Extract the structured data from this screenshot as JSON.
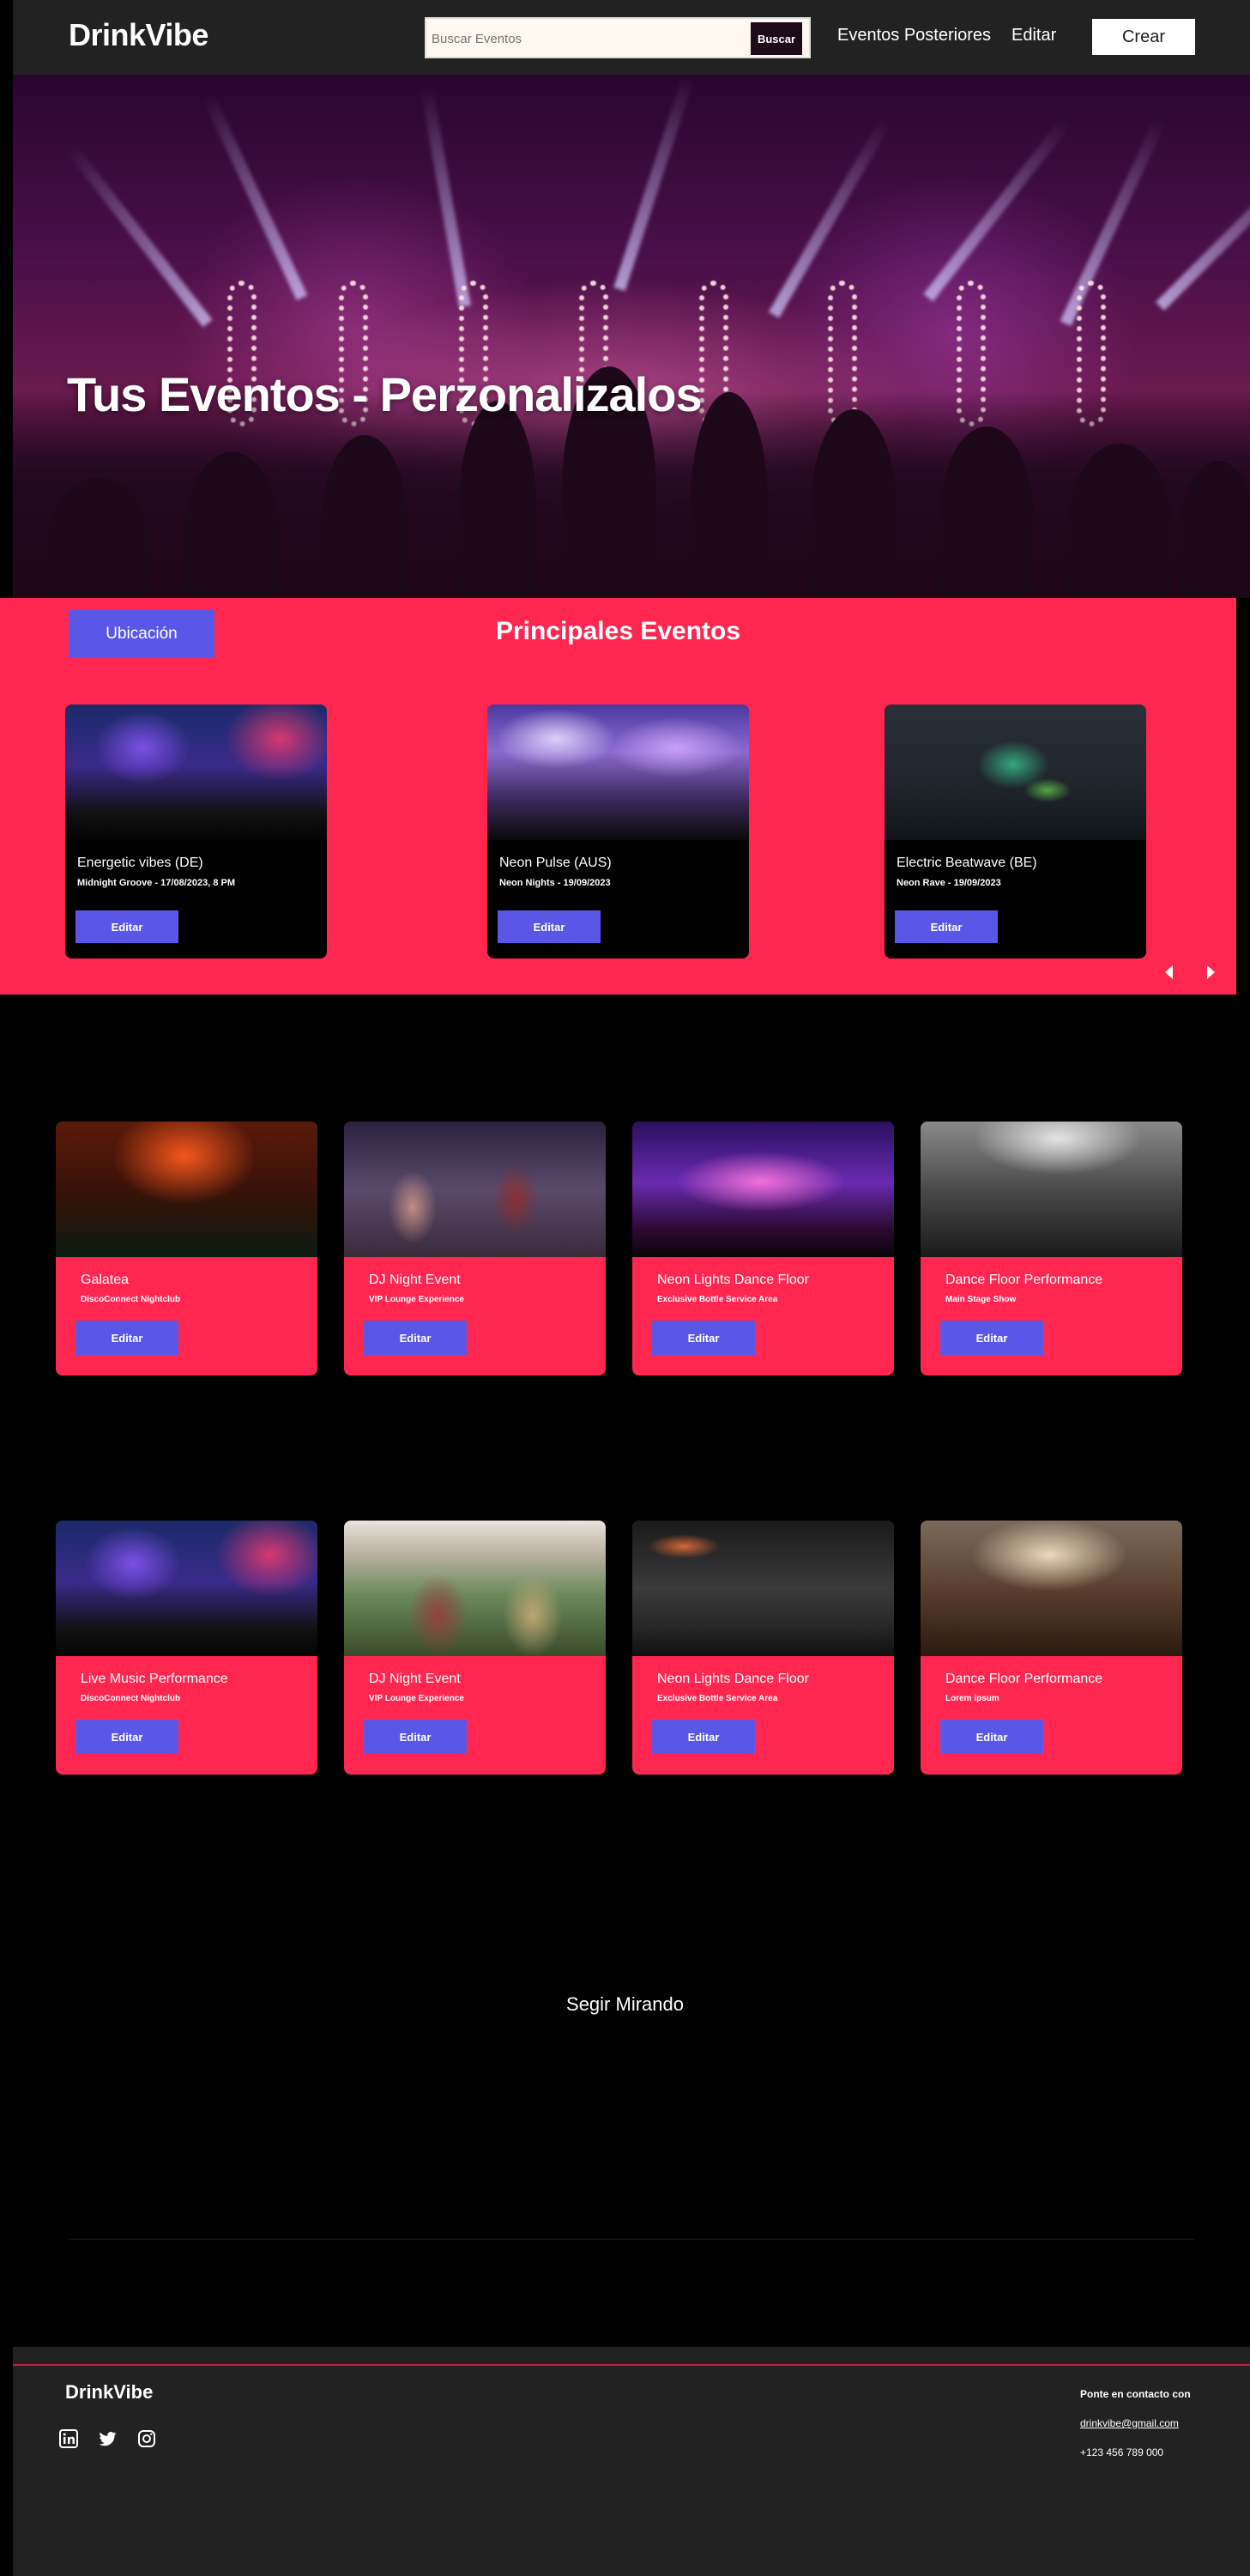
{
  "nav": {
    "brand": "DrinkVibe",
    "search_placeholder": "Buscar Eventos",
    "search_button": "Buscar",
    "links": [
      "Eventos Posteriores",
      "Editar"
    ],
    "create_button": "Crear"
  },
  "hero": {
    "title": "Tus Eventos - Perzonalizalos"
  },
  "principales": {
    "location_button": "Ubicación",
    "title": "Principales Eventos",
    "cards": [
      {
        "title": "Energetic vibes (DE)",
        "subtitle": "Midnight Groove - 17/08/2023, 8 PM",
        "button": "Editar",
        "image": "stage-crowd"
      },
      {
        "title": "Neon Pulse (AUS)",
        "subtitle": "Neon Nights - 19/09/2023",
        "button": "Editar",
        "image": "smoke-crowd"
      },
      {
        "title": "Electric Beatwave (BE)",
        "subtitle": "Neon Rave - 19/09/2023",
        "button": "Editar",
        "image": "laser-crowd"
      }
    ],
    "prev_icon": "caret-left-icon",
    "next_icon": "caret-right-icon"
  },
  "grid_row1": [
    {
      "title": "Galatea",
      "subtitle": "DiscoConnect Nightclub",
      "button": "Editar",
      "image": "orange-crowd"
    },
    {
      "title": "DJ Night Event",
      "subtitle": "VIP Lounge Experience",
      "button": "Editar",
      "image": "wine-toast"
    },
    {
      "title": "Neon Lights Dance Floor",
      "subtitle": "Exclusive Bottle Service Area",
      "button": "Editar",
      "image": "purple-crowd"
    },
    {
      "title": "Dance Floor Performance",
      "subtitle": "Main Stage Show",
      "button": "Editar",
      "image": "bw-crowd"
    }
  ],
  "grid_row2": [
    {
      "title": "Live Music Performance",
      "subtitle": "DiscoConnect Nightclub",
      "button": "Editar",
      "image": "stage-crowd"
    },
    {
      "title": "DJ Night Event",
      "subtitle": "VIP Lounge Experience",
      "button": "Editar",
      "image": "festival-couple"
    },
    {
      "title": "Neon Lights Dance Floor",
      "subtitle": "Exclusive Bottle Service Area",
      "button": "Editar",
      "image": "dj-mixer"
    },
    {
      "title": "Dance Floor Performance",
      "subtitle": "Lorem ipsum",
      "button": "Editar",
      "image": "heart-hands"
    }
  ],
  "more_label": "Segir Mirando",
  "footer": {
    "brand": "DrinkVibe",
    "social_icons": [
      "linkedin-icon",
      "twitter-icon",
      "instagram-icon"
    ],
    "contact_heading": "Ponte en contacto con",
    "email": "drinkvibe@gmail.com",
    "phone": "+123 456 789 000"
  },
  "colors": {
    "accent": "#ff2650",
    "button": "#5b57e6",
    "nav_bg": "#222222",
    "page_bg": "#000000"
  }
}
